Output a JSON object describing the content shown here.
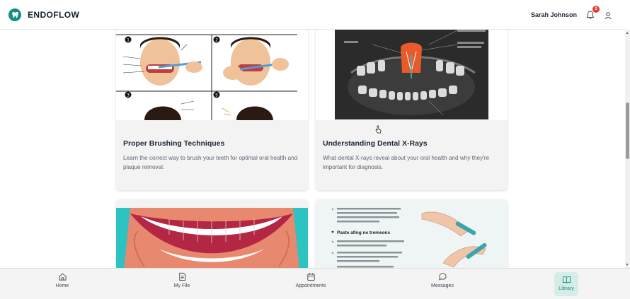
{
  "header": {
    "brand": "ENDOFLOW",
    "user_name": "Sarah Johnson",
    "notification_count": "2"
  },
  "articles": [
    {
      "title": "Proper Brushing Techniques",
      "description": "Learn the correct way to brush your teeth for optimal oral health and plaque removal.",
      "steps": [
        "1",
        "2",
        "3",
        "5"
      ]
    },
    {
      "title": "Understanding Dental X-Rays",
      "description": "What dental X-rays reveal about your oral health and why they're important for diagnosis."
    },
    {
      "title": "",
      "description": ""
    },
    {
      "title": "",
      "description": "",
      "heading": "Paste afing ne tremeons"
    }
  ],
  "bottom_nav": [
    {
      "label": "Home",
      "icon": "home-icon"
    },
    {
      "label": "My File",
      "icon": "file-icon"
    },
    {
      "label": "Appointments",
      "icon": "calendar-icon"
    },
    {
      "label": "Messages",
      "icon": "message-icon"
    },
    {
      "label": "Library",
      "icon": "book-icon",
      "active": true
    }
  ],
  "colors": {
    "accent": "#0f8f86",
    "badge": "#e53935",
    "card_bg": "#f3f3f3"
  }
}
